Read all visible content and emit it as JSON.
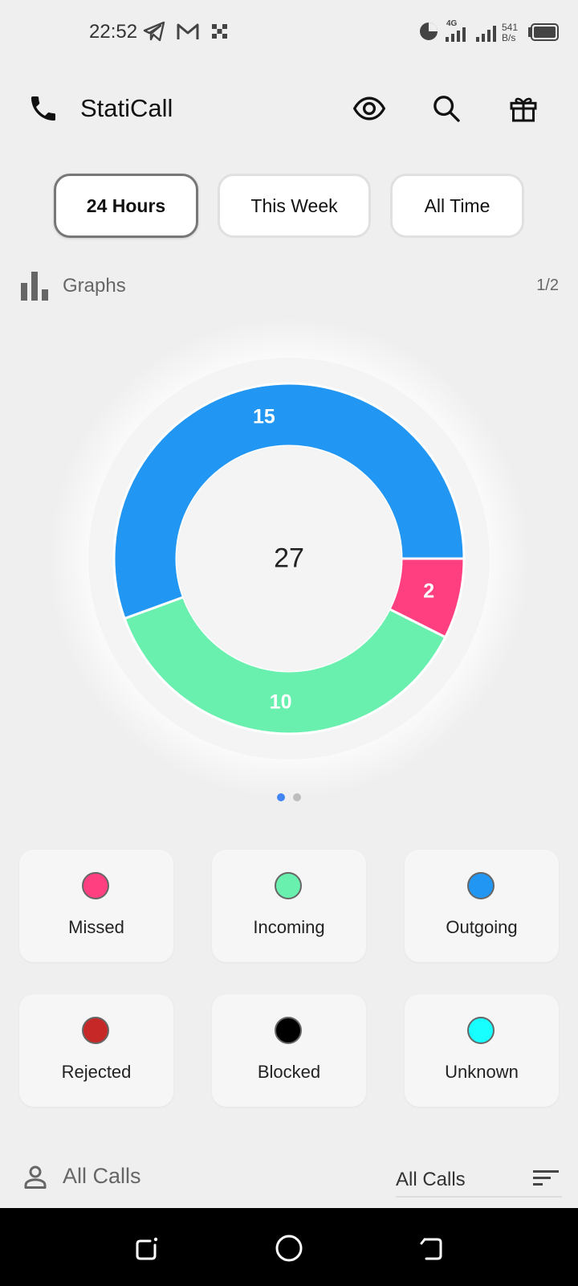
{
  "status_bar": {
    "time": "22:52",
    "network_type": "4G",
    "speed_value": "541",
    "speed_unit": "B/s",
    "icons": [
      "telegram-icon",
      "gmail-icon",
      "app-grid-icon",
      "data-saver-icon",
      "signal-icon",
      "signal-icon",
      "battery-icon"
    ]
  },
  "app_bar": {
    "title": "StatiCall",
    "icons": [
      "phone-icon",
      "eye-icon",
      "search-icon",
      "gift-icon"
    ]
  },
  "period_tabs": [
    {
      "label": "24 Hours",
      "active": true
    },
    {
      "label": "This Week",
      "active": false
    },
    {
      "label": "All Time",
      "active": false
    }
  ],
  "graphs_section": {
    "title": "Graphs",
    "page_indicator": "1/2",
    "icon": "bar-chart-icon"
  },
  "chart_data": {
    "type": "pie",
    "variant": "donut",
    "total": "27",
    "slices": [
      {
        "label": "Missed",
        "value": 2,
        "color": "#FF3F80"
      },
      {
        "label": "Incoming",
        "value": 10,
        "color": "#69F0AE"
      },
      {
        "label": "Outgoing",
        "value": 15,
        "color": "#2196F3"
      }
    ]
  },
  "pager_dots": {
    "count": 2,
    "active_index": 0,
    "active_color": "#4285F4",
    "inactive_color": "#BDBDBD"
  },
  "legend": [
    {
      "label": "Missed",
      "color": "#FF3F80"
    },
    {
      "label": "Incoming",
      "color": "#69F0AE"
    },
    {
      "label": "Outgoing",
      "color": "#2196F3"
    },
    {
      "label": "Rejected",
      "color": "#C62828"
    },
    {
      "label": "Blocked",
      "color": "#000000"
    },
    {
      "label": "Unknown",
      "color": "#18FFFF"
    }
  ],
  "calls_section": {
    "title": "All Calls",
    "filter_value": "All Calls",
    "icons": [
      "person-icon",
      "sort-icon"
    ]
  },
  "nav_bar": {
    "icons": [
      "recents-icon",
      "home-icon",
      "back-icon"
    ]
  }
}
